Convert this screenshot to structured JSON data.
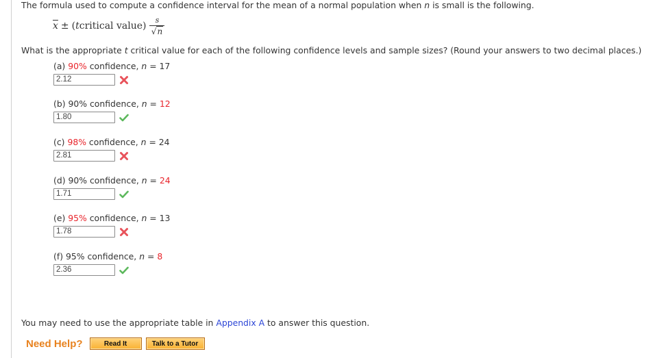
{
  "intro": {
    "before_n": "The formula used to compute a confidence interval for the mean of a normal population when ",
    "n_symbol": "n",
    "after_n": " is small is the following."
  },
  "formula": {
    "xbar": "x",
    "pm": "±",
    "open_paren": "(",
    "t": "t",
    "critical_value": " critical value)",
    "numerator": "s",
    "sqrt": "√",
    "denominator": "n"
  },
  "question": {
    "before_t": "What is the appropriate ",
    "t_symbol": "t",
    "after_t": " critical value for each of the following confidence levels and sample sizes? (Round your answers to two decimal places.)"
  },
  "parts": [
    {
      "letter": "(a)",
      "confidence": "90%",
      "confidence_highlight": true,
      "word": " confidence, ",
      "n_symbol": "n",
      "equals": " = ",
      "n_value": "17",
      "n_highlight": false,
      "answer": "2.12",
      "status": "incorrect",
      "status_icon": "x-icon"
    },
    {
      "letter": "(b)",
      "confidence": "90%",
      "confidence_highlight": false,
      "word": " confidence, ",
      "n_symbol": "n",
      "equals": " = ",
      "n_value": "12",
      "n_highlight": true,
      "answer": "1.80",
      "status": "correct",
      "status_icon": "check-icon"
    },
    {
      "letter": "(c)",
      "confidence": "98%",
      "confidence_highlight": true,
      "word": " confidence, ",
      "n_symbol": "n",
      "equals": " = ",
      "n_value": "24",
      "n_highlight": false,
      "answer": "2.81",
      "status": "incorrect",
      "status_icon": "x-icon"
    },
    {
      "letter": "(d)",
      "confidence": "90%",
      "confidence_highlight": false,
      "word": " confidence, ",
      "n_symbol": "n",
      "equals": " = ",
      "n_value": "24",
      "n_highlight": true,
      "answer": "1.71",
      "status": "correct",
      "status_icon": "check-icon"
    },
    {
      "letter": "(e)",
      "confidence": "95%",
      "confidence_highlight": true,
      "word": " confidence, ",
      "n_symbol": "n",
      "equals": " = ",
      "n_value": "13",
      "n_highlight": false,
      "answer": "1.78",
      "status": "incorrect",
      "status_icon": "x-icon"
    },
    {
      "letter": "(f)",
      "confidence": "95%",
      "confidence_highlight": false,
      "word": " confidence, ",
      "n_symbol": "n",
      "equals": " = ",
      "n_value": "8",
      "n_highlight": true,
      "answer": "2.36",
      "status": "correct",
      "status_icon": "check-icon"
    }
  ],
  "appendix": {
    "before": "You may need to use the appropriate table in ",
    "link": "Appendix A",
    "after": " to answer this question."
  },
  "help": {
    "label": "Need Help?",
    "read_it": "Read It",
    "talk_to_tutor": "Talk to a Tutor"
  },
  "colors": {
    "highlight_red": "#e8242b",
    "correct_green": "#5cb85c",
    "incorrect_red": "#e8525a",
    "link_blue": "#2b45d6",
    "help_orange": "#e8821e"
  }
}
